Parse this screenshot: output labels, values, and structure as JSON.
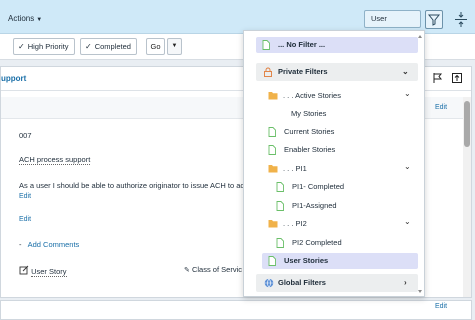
{
  "topbar": {
    "actions_label": "Actions",
    "view_select_label": "User Stories",
    "filter_icon": "filter-icon",
    "split_icon": "split-view-icon"
  },
  "toolbar": {
    "checkboxes": [
      {
        "label": "High Priority",
        "checked": true
      },
      {
        "label": "Completed",
        "checked": true
      }
    ],
    "go_label": "Go"
  },
  "record": {
    "title_fragment": "upport",
    "id_value": "007",
    "name_value": "ACH process support",
    "description_value": "As a user I should be able to authorize originator to issue ACH to acc",
    "edit_label": "Edit",
    "add_comments_label": "Add Comments",
    "type_value": "User Story",
    "class_of_service_fragment": "Class of Servic"
  },
  "filter_menu": {
    "no_filter_label": "... No Filter ...",
    "private_filters_label": "Private Filters",
    "global_filters_label": "Global Filters",
    "items": [
      {
        "label": ". . . Active Stories",
        "kind": "folder",
        "level": 0,
        "expanded": true
      },
      {
        "label": "My Stories",
        "kind": "file",
        "level": 1
      },
      {
        "label": "Current Stories",
        "kind": "file",
        "level": 0
      },
      {
        "label": "Enabler Stories",
        "kind": "file",
        "level": 0
      },
      {
        "label": ". . . PI1",
        "kind": "folder",
        "level": 0,
        "expanded": true
      },
      {
        "label": "PI1- Completed",
        "kind": "file",
        "level": 1
      },
      {
        "label": "PI1-Assigned",
        "kind": "file",
        "level": 1
      },
      {
        "label": ". . . PI2",
        "kind": "folder",
        "level": 0,
        "expanded": true
      },
      {
        "label": "PI2 Completed",
        "kind": "file",
        "level": 1
      },
      {
        "label": "User Stories",
        "kind": "file",
        "level": 0,
        "selected": true
      }
    ]
  },
  "colors": {
    "accent": "#1a6fa8",
    "highlight": "#dcdff7",
    "folder": "#f0b24a",
    "file": "#4caf50"
  }
}
